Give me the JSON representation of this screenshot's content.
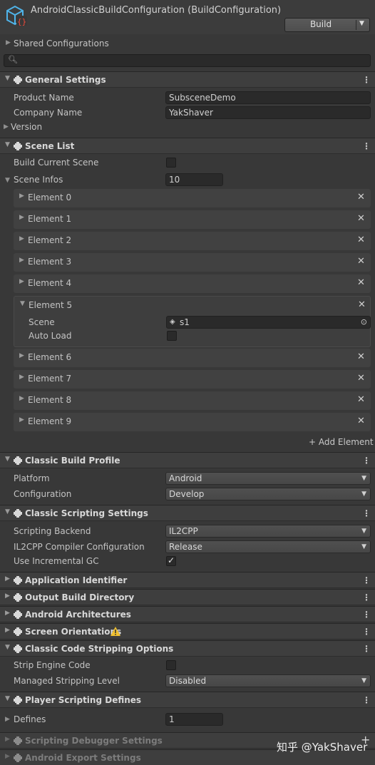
{
  "header": {
    "title": "AndroidClassicBuildConfiguration (BuildConfiguration)",
    "build_button": "Build",
    "shared_configs": "Shared Configurations"
  },
  "search": {
    "placeholder": ""
  },
  "general": {
    "title": "General Settings",
    "product_name_label": "Product Name",
    "product_name_value": "SubsceneDemo",
    "company_name_label": "Company Name",
    "company_name_value": "YakShaver",
    "version_label": "Version"
  },
  "scene_list": {
    "title": "Scene List",
    "build_current_label": "Build Current Scene",
    "build_current_checked": false,
    "scene_infos_label": "Scene Infos",
    "scene_infos_count": "10",
    "elements": [
      {
        "label": "Element 0"
      },
      {
        "label": "Element 1"
      },
      {
        "label": "Element 2"
      },
      {
        "label": "Element 3"
      },
      {
        "label": "Element 4"
      },
      {
        "label": "Element 5"
      },
      {
        "label": "Element 6"
      },
      {
        "label": "Element 7"
      },
      {
        "label": "Element 8"
      },
      {
        "label": "Element 9"
      }
    ],
    "element5": {
      "scene_label": "Scene",
      "scene_value": "s1",
      "auto_load_label": "Auto Load",
      "auto_load_checked": false
    },
    "add_element": "+ Add Element"
  },
  "build_profile": {
    "title": "Classic Build Profile",
    "platform_label": "Platform",
    "platform_value": "Android",
    "configuration_label": "Configuration",
    "configuration_value": "Develop"
  },
  "scripting": {
    "title": "Classic Scripting Settings",
    "backend_label": "Scripting Backend",
    "backend_value": "IL2CPP",
    "compiler_label": "IL2CPP Compiler Configuration",
    "compiler_value": "Release",
    "incremental_label": "Use Incremental GC",
    "incremental_checked": true
  },
  "collapsed_sections": {
    "app_id": "Application Identifier",
    "output_dir": "Output Build Directory",
    "android_arch": "Android Architectures",
    "screen_orient": "Screen Orientations"
  },
  "stripping": {
    "title": "Classic Code Stripping Options",
    "strip_engine_label": "Strip Engine Code",
    "strip_engine_checked": false,
    "managed_level_label": "Managed Stripping Level",
    "managed_level_value": "Disabled"
  },
  "defines": {
    "title": "Player Scripting Defines",
    "defines_label": "Defines",
    "defines_count": "1"
  },
  "disabled_sections": {
    "debugger": "Scripting Debugger Settings",
    "export": "Android Export Settings"
  },
  "watermark": "知乎 @YakShaver",
  "colors": {
    "background": "#383838",
    "section_header": "#3e3e3e",
    "field": "#2a2a2a",
    "warning": "#f0c030",
    "icon_blue": "#4fb3e8"
  }
}
